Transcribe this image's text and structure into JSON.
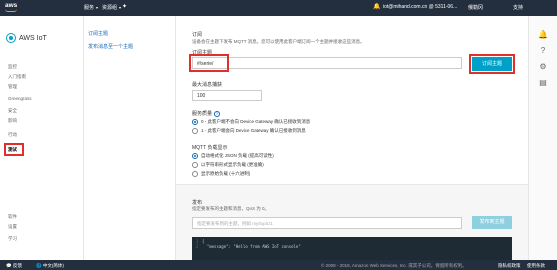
{
  "topbar": {
    "logo": "aws",
    "services": "服务",
    "resource_groups": "资源组",
    "account": "iot@mihand.com.cn @ 5311-06...",
    "region": "俄勒冈",
    "support": "支持"
  },
  "sidebar": {
    "brand": "AWS IoT",
    "items": [
      {
        "label": "监控"
      },
      {
        "label": "入门指南"
      },
      {
        "label": "管理"
      },
      {
        "label": "Greengrass"
      },
      {
        "label": "安全"
      },
      {
        "label": "影响"
      },
      {
        "label": "行动"
      },
      {
        "label": "测试"
      },
      {
        "label": "软件"
      },
      {
        "label": "设置"
      },
      {
        "label": "学习"
      }
    ]
  },
  "subnav": {
    "items": [
      {
        "label": "订阅主题"
      },
      {
        "label": "发布消息至一个主题"
      }
    ]
  },
  "main": {
    "subscribe": {
      "title": "订阅",
      "desc": "设备会在主题下发布 MQTT 消息。您可以使用此客户端订阅一个主题并接收这些消息。",
      "topic_label": "订阅主题",
      "topic_value": "#/serie/",
      "button": "订阅主题"
    },
    "max_msg": {
      "label": "最大消息捕获",
      "value": "100"
    },
    "qos": {
      "label": "服务质量",
      "options": [
        "0 - 此客户端不会向 Device Gateway 确认已接收到消息",
        "1 - 此客户端会向 Device Gateway 确认已接收到消息"
      ]
    },
    "mqtt_display": {
      "label": "MQTT 负载显示",
      "options": [
        "自动格式化 JSON 负载 (提高可读性)",
        "以字符串形式显示负载 (更准确)",
        "显示原始负载 (十六进制)"
      ]
    },
    "publish": {
      "title": "发布",
      "desc": "指定要发布的主题和消息，QoS 为 0。",
      "placeholder": "指定要发布到的主题，例如 my/topic/1",
      "button": "发布到主题",
      "code_line1": "{",
      "code_line2": "\"message\": \"Hello from AWS IoT console\""
    }
  },
  "footer": {
    "feedback": "反馈",
    "language": "中文(简体)",
    "copyright": "© 2008 - 2018, Amazon Web Services, Inc. 或其子公司。保留所有权利。",
    "privacy": "隐私权政策",
    "terms": "使用条款"
  },
  "colors": {
    "accent": "#00a1c9",
    "highlight": "#e0302b",
    "nav_bg": "#232f3e"
  }
}
